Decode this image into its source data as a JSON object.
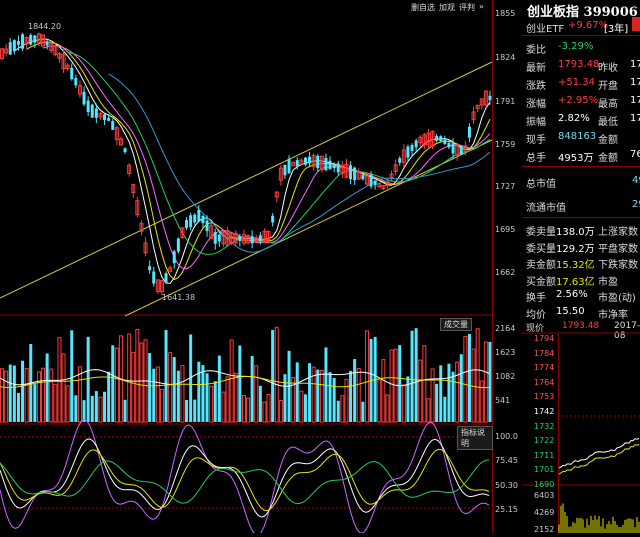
{
  "toolbar": {
    "self_select": "删自选",
    "watch": "加观",
    "report": "评判"
  },
  "price_chart": {
    "high_label": "1844.20",
    "low_label": "1641.38",
    "y_ticks": [
      "1855",
      "1824",
      "1791",
      "1759",
      "1727",
      "1695",
      "1662"
    ]
  },
  "volume_chart": {
    "label": "成交量",
    "y_ticks": [
      "2164",
      "1623",
      "1082",
      "541"
    ]
  },
  "indicator_chart": {
    "label": "指标说明",
    "y_ticks": [
      "100.0",
      "75.45",
      "50.30",
      "25.15"
    ]
  },
  "quote": {
    "title": "创业板指 399006",
    "etf_label": "创业ETF",
    "etf_change": "+9.67%",
    "etf_tag": "[3年]",
    "rows": [
      {
        "l1": "委比",
        "v1": "-3.29%",
        "c1": "grn"
      },
      {
        "l1": "最新",
        "v1": "1793.48",
        "c1": "red",
        "l2": "昨收",
        "v2": "17"
      },
      {
        "l1": "涨跌",
        "v1": "+51.34",
        "c1": "red",
        "l2": "开盘",
        "v2": "17"
      },
      {
        "l1": "涨幅",
        "v1": "+2.95%",
        "c1": "red",
        "l2": "最高",
        "v2": "17"
      },
      {
        "l1": "振幅",
        "v1": "2.82%",
        "c1": "wht",
        "l2": "最低",
        "v2": "17"
      },
      {
        "l1": "现手",
        "v1": "848163",
        "c1": "cyan",
        "l2": "金额",
        "v2": ""
      },
      {
        "l1": "总手",
        "v1": "4953万",
        "c1": "wht",
        "l2": "金额",
        "v2": "76"
      }
    ],
    "cap": [
      {
        "label": "总市值",
        "value": "49"
      },
      {
        "label": "流通市值",
        "value": "29"
      }
    ],
    "stats": [
      {
        "l1": "委卖量",
        "v1": "138.0万",
        "c1": "wht",
        "l2": "上涨家数",
        "v2": ""
      },
      {
        "l1": "委买量",
        "v1": "129.2万",
        "c1": "wht",
        "l2": "平盘家数",
        "v2": ""
      },
      {
        "l1": "卖金额",
        "v1": "15.32亿",
        "c1": "yel",
        "l2": "下跌家数",
        "v2": ""
      },
      {
        "l1": "买金额",
        "v1": "17.63亿",
        "c1": "yel",
        "l2": "市盈",
        "v2": ""
      },
      {
        "l1": "换手",
        "v1": "2.56%",
        "c1": "wht",
        "l2": "市盈(动)",
        "v2": ""
      },
      {
        "l1": "均价",
        "v1": "15.50",
        "c1": "wht",
        "l2": "市净率",
        "v2": ""
      }
    ]
  },
  "mini_chart": {
    "now_label": "现价",
    "now_value": "1793.48",
    "date": "2017-08",
    "y_ticks": [
      "1794",
      "1784",
      "1774",
      "1764",
      "1753",
      "1742",
      "1732",
      "1722",
      "1711",
      "1701",
      "1690"
    ],
    "vol_ticks": [
      "6403",
      "4269",
      "2152"
    ]
  },
  "colors": {
    "up": "#ff3b3b",
    "down": "#54e6ff",
    "ma5": "#ffffff",
    "ma10": "#e6e600",
    "ma20": "#ff66ff",
    "ma30": "#22cc66",
    "ma60": "#3399cc",
    "channel": "#cccc44"
  }
}
